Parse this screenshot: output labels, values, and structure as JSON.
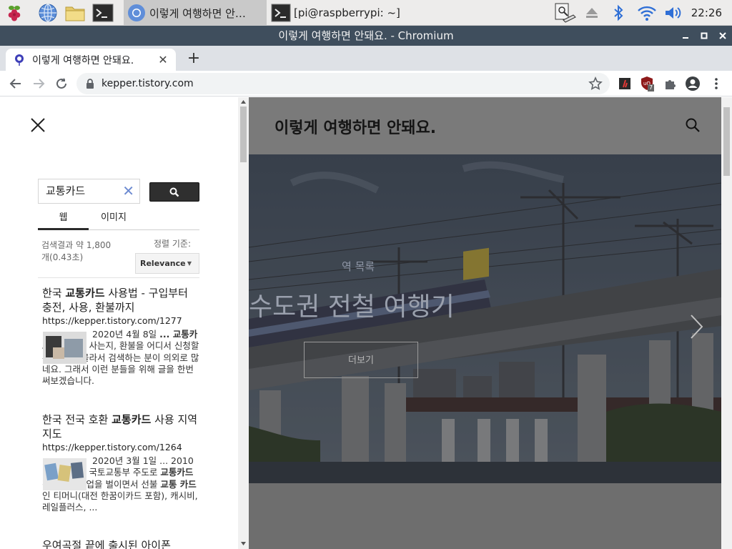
{
  "taskbar": {
    "tasks": [
      {
        "label": "이렇게 여행하면 안…"
      },
      {
        "label": "[pi@raspberrypi: ~]"
      }
    ],
    "clock": "22:26"
  },
  "window": {
    "title": "이렇게 여행하면 안돼요. - Chromium"
  },
  "browser": {
    "tab_title": "이렇게 여행하면 안돼요.",
    "new_tab": "+",
    "url": "kepper.tistory.com",
    "ext_badge": "7"
  },
  "search_panel": {
    "query": "교통카드",
    "tabs": [
      "웹",
      "이미지"
    ],
    "result_info": "검색결과 약 1,800 개(0.43초)",
    "sort_label": "정렬 기준:",
    "sort_value": "Relevance",
    "results": [
      {
        "title_pre": "한국 ",
        "title_bold": "교통카드",
        "title_post": " 사용법 - 구입부터 충전, 사용, 환불까지",
        "url": "https://kepper.tistory.com/1277",
        "snip_pre": "2020년 4월 8일 ",
        "snip_bold": "... 교통카드",
        "snip_post": "를 어디서 사는지, 환불을 어디서 신청할 수 있는지 몰라서 검색하는 분이 의외로 많네요. 그래서 이런 분들을 위해 글을 한번 써보겠습니다."
      },
      {
        "title_pre": "한국 전국 호환 ",
        "title_bold": "교통카드",
        "title_post": " 사용 지역 지도",
        "url": "https://kepper.tistory.com/1264",
        "snip_pre": "2020년 3월 1일 ... 2010년대 들어서 국토교통부 주도로 ",
        "snip_bold": "교통카드",
        "snip_mid": " 전국호환 사업을 벌이면서 선불 ",
        "snip_bold2": "교통 카드",
        "snip_post": "인 티머니(대전 한꿈이카드 포함), 캐시비, 레일플러스, ..."
      }
    ],
    "cut_result": "우여곡절 끝에 출시된 아이폰"
  },
  "blog": {
    "site_title": "이렇게 여행하면 안돼요.",
    "hero_category": "역 목록",
    "hero_title": "수도권 전철 여행기",
    "hero_more": "더보기"
  }
}
